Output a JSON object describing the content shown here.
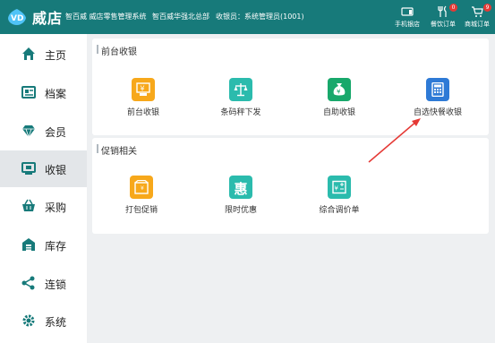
{
  "header": {
    "app_name": "威店",
    "system_name": "智百威 威店零售管理系统",
    "store": "智百威华强北总部",
    "cashier": "收银员：系统管理员(1001)",
    "actions": [
      {
        "label": "手机银店",
        "icon": "mobile-store-icon",
        "badge": ""
      },
      {
        "label": "餐饮订单",
        "icon": "dining-order-icon",
        "badge": "0"
      },
      {
        "label": "商城订单",
        "icon": "mall-order-icon",
        "badge": "9"
      }
    ],
    "color": "#177a7a"
  },
  "sidebar": {
    "items": [
      {
        "label": "主页",
        "icon": "home-icon"
      },
      {
        "label": "档案",
        "icon": "archive-icon"
      },
      {
        "label": "会员",
        "icon": "member-icon"
      },
      {
        "label": "收银",
        "icon": "cashier-icon",
        "active": true
      },
      {
        "label": "采购",
        "icon": "purchase-icon"
      },
      {
        "label": "库存",
        "icon": "inventory-icon"
      },
      {
        "label": "连锁",
        "icon": "chain-icon"
      },
      {
        "label": "系统",
        "icon": "system-icon"
      }
    ]
  },
  "sections": [
    {
      "title": "前台收银",
      "tiles": [
        {
          "label": "前台收银",
          "icon": "front-cashier-icon",
          "color": "#f7a81b"
        },
        {
          "label": "条码秤下发",
          "icon": "scale-icon",
          "color": "#2bbbad"
        },
        {
          "label": "自助收银",
          "icon": "money-bag-icon",
          "color": "#18a86b"
        },
        {
          "label": "自选快餐收银",
          "icon": "calculator-icon",
          "color": "#2e7ad6"
        }
      ]
    },
    {
      "title": "促销相关",
      "tiles": [
        {
          "label": "打包促销",
          "icon": "package-promo-icon",
          "color": "#f7a81b"
        },
        {
          "label": "限时优惠",
          "icon": "discount-icon",
          "color": "#2bbbad"
        },
        {
          "label": "综合调价单",
          "icon": "price-adjust-icon",
          "color": "#2bbbad"
        }
      ]
    }
  ],
  "tile_glyphs": {
    "discount": "惠"
  },
  "annotation": {
    "color": "#e53935"
  }
}
